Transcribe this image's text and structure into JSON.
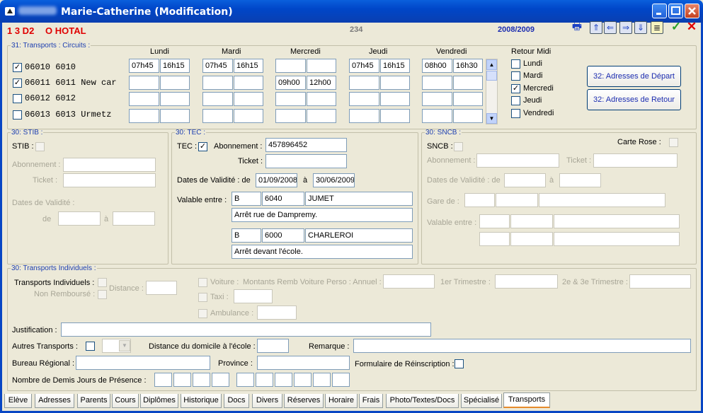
{
  "window": {
    "title": "Marie-Catherine (Modification)"
  },
  "header": {
    "class": "1 3 D2",
    "name": "O HOTAL",
    "number": "234",
    "year": "2008/2009"
  },
  "toolbar": {
    "icons": [
      "print-icon",
      "first-icon",
      "prev-icon",
      "next-icon",
      "last-icon",
      "card-icon",
      "confirm-icon",
      "cancel-icon"
    ]
  },
  "transports": {
    "legend": "31: Transports : Circuits :",
    "days": [
      "Lundi",
      "Mardi",
      "Mercredi",
      "Jeudi",
      "Vendredi"
    ],
    "circuits": [
      {
        "checked": true,
        "code": "06010 6010",
        "times": [
          [
            "07h45",
            "16h15"
          ],
          [
            "07h45",
            "16h15"
          ],
          [
            "",
            ""
          ],
          [
            "07h45",
            "16h15"
          ],
          [
            "08h00",
            "16h30"
          ]
        ]
      },
      {
        "checked": true,
        "code": "06011 6011 New car",
        "times": [
          [
            "",
            ""
          ],
          [
            "",
            ""
          ],
          [
            "09h00",
            "12h00"
          ],
          [
            "",
            ""
          ],
          [
            "",
            ""
          ]
        ]
      },
      {
        "checked": false,
        "code": "06012 6012",
        "times": [
          [
            "",
            ""
          ],
          [
            "",
            ""
          ],
          [
            "",
            ""
          ],
          [
            "",
            ""
          ],
          [
            "",
            ""
          ]
        ]
      },
      {
        "checked": false,
        "code": "06013 6013 Urmetz",
        "times": [
          [
            "",
            ""
          ],
          [
            "",
            ""
          ],
          [
            "",
            ""
          ],
          [
            "",
            ""
          ],
          [
            "",
            ""
          ]
        ]
      }
    ],
    "retour_midi": {
      "title": "Retour Midi",
      "items": [
        {
          "label": "Lundi",
          "checked": false
        },
        {
          "label": "Mardi",
          "checked": false
        },
        {
          "label": "Mercredi",
          "checked": true
        },
        {
          "label": "Jeudi",
          "checked": false
        },
        {
          "label": "Vendredi",
          "checked": false
        }
      ]
    },
    "btn_depart": "32: Adresses de Départ",
    "btn_retour": "32: Adresses de Retour"
  },
  "stib": {
    "legend": "30: STIB :",
    "label": "STIB :",
    "abonnement": "Abonnement :",
    "ticket": "Ticket :",
    "dates": "Dates de Validité :",
    "de": "de",
    "a": "à"
  },
  "tec": {
    "legend": "30: TEC :",
    "label": "TEC :",
    "abonnement_label": "Abonnement :",
    "abonnement": "457896452",
    "ticket_label": "Ticket :",
    "dates_label": "Dates de Validité : de",
    "date_from": "01/09/2008",
    "a": "à",
    "date_to": "30/06/2009",
    "valable_label": "Valable entre :",
    "stop1": {
      "country": "B",
      "zip": "6040",
      "city": "JUMET",
      "desc": "Arrêt rue de Dampremy."
    },
    "stop2": {
      "country": "B",
      "zip": "6000",
      "city": "CHARLEROI",
      "desc": "Arrêt devant l'école."
    }
  },
  "sncb": {
    "legend": "30: SNCB :",
    "label": "SNCB :",
    "carte_rose": "Carte Rose :",
    "abonnement": "Abonnement :",
    "ticket": "Ticket :",
    "dates": "Dates de Validité : de",
    "a": "à",
    "gare": "Gare de :",
    "valable": "Valable entre :"
  },
  "indiv": {
    "legend": "30: Transports Individuels :",
    "ti_label": "Transports Individuels :",
    "non_rembourse": "Non Remboursé :",
    "distance": "Distance :",
    "voiture": "Voiture :",
    "montants": "Montants Remb Voiture Perso : Annuel :",
    "trim1": "1er Trimestre :",
    "trim23": "2e & 3e Trimestre :",
    "taxi": "Taxi :",
    "ambulance": "Ambulance :",
    "justification": "Justification :",
    "autres": "Autres Transports :",
    "distance_domicile": "Distance du domicile à l'école :",
    "remarque": "Remarque :",
    "bureau": "Bureau Régional :",
    "province": "Province :",
    "formulaire": "Formulaire de Réinscription :",
    "demis_jours": "Nombre de Demis Jours de Présence :"
  },
  "tabs": [
    "Elève",
    "Adresses",
    "Parents",
    "Cours",
    "Diplômes",
    "Historique",
    "Docs",
    "Divers",
    "Réserves",
    "Horaire",
    "Frais",
    "Photo/Textes/Docs",
    "Spécialisé",
    "Transports"
  ],
  "colors": {
    "accent_red": "#e00000",
    "accent_blue": "#1c2db0",
    "title_blue": "#0a5fdc"
  }
}
